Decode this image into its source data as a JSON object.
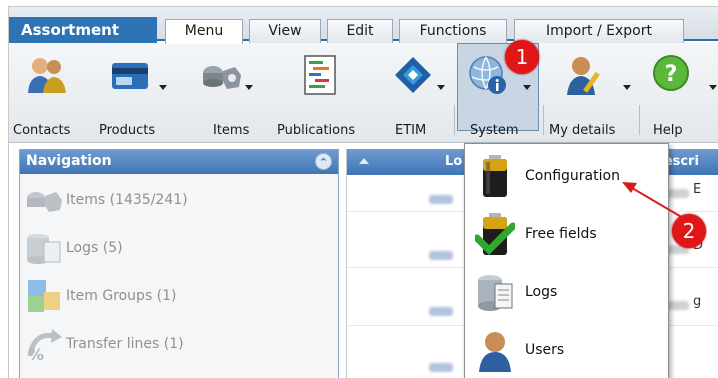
{
  "app": {
    "title": "Assortment"
  },
  "tabs": [
    {
      "label": "Menu",
      "active": true
    },
    {
      "label": "View"
    },
    {
      "label": "Edit"
    },
    {
      "label": "Functions"
    },
    {
      "label": "Import / Export"
    }
  ],
  "toolbar": {
    "items": [
      {
        "label": "Contacts",
        "icon": "contacts-icon"
      },
      {
        "label": "Products",
        "icon": "products-icon",
        "dropdown": true
      },
      {
        "label": "Items",
        "icon": "items-icon",
        "dropdown": true
      },
      {
        "label": "Publications",
        "icon": "publications-icon"
      },
      {
        "label": "ETIM",
        "icon": "etim-icon",
        "dropdown": true
      },
      {
        "label": "System",
        "icon": "system-icon",
        "dropdown": true,
        "selected": true
      },
      {
        "label": "My details",
        "icon": "my-details-icon",
        "dropdown": true
      },
      {
        "label": "Help",
        "icon": "help-icon",
        "dropdown": true
      }
    ]
  },
  "navigation": {
    "title": "Navigation",
    "items": [
      {
        "label": "Items (1435/241)",
        "icon": "items-icon"
      },
      {
        "label": "Logs (5)",
        "icon": "logs-icon"
      },
      {
        "label": "Item Groups (1)",
        "icon": "item-groups-icon"
      },
      {
        "label": "Transfer lines (1)",
        "icon": "transfer-lines-icon"
      }
    ]
  },
  "grid": {
    "columns": [
      "Lo",
      "Descri"
    ],
    "row_suffixes": [
      "E",
      "D",
      "g"
    ]
  },
  "system_menu": {
    "items": [
      {
        "label": "Configuration",
        "icon": "battery-icon"
      },
      {
        "label": "Free fields",
        "icon": "battery-check-icon"
      },
      {
        "label": "Logs",
        "icon": "logs-icon"
      },
      {
        "label": "Users",
        "icon": "user-icon"
      }
    ]
  },
  "callouts": [
    "1",
    "2"
  ],
  "colors": {
    "accent": "#2e73b3",
    "callout": "#e11717",
    "header": "#3f75b5"
  }
}
